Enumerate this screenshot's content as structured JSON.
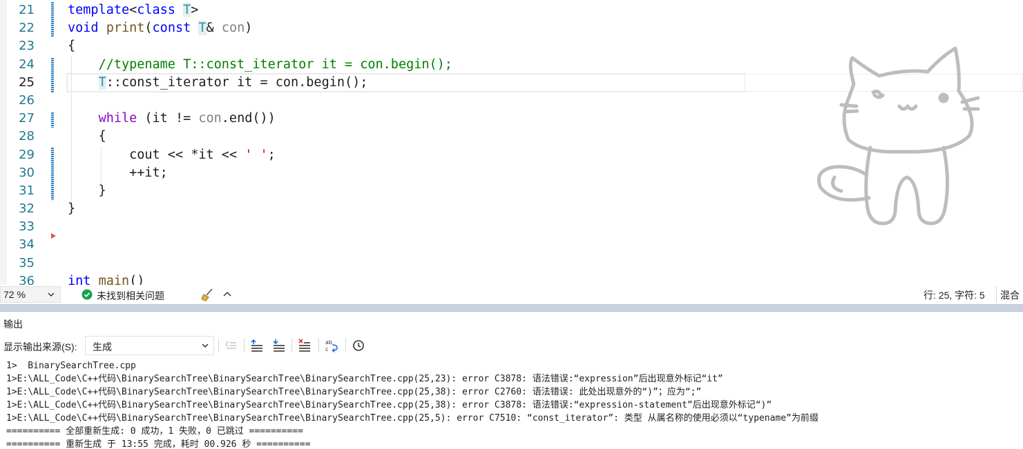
{
  "editor": {
    "line_numbers": [
      "21",
      "22",
      "23",
      "24",
      "25",
      "26",
      "27",
      "28",
      "29",
      "30",
      "31",
      "32",
      "33",
      "34",
      "35",
      "36"
    ],
    "current_line": "25",
    "code": {
      "l21_kw": "template",
      "l21_a": "<",
      "l21_kw2": "class",
      "l21_sp": " ",
      "l21_T": "T",
      "l21_b": ">",
      "l22_kw": "void",
      "l22_sp": " ",
      "l22_fn": "print",
      "l22_paren": "(",
      "l22_const": "const",
      "l22_sp2": " ",
      "l22_T": "T",
      "l22_amp": "& ",
      "l22_prm": "con",
      "l22_close": ")",
      "l23": "{",
      "l24_indent": "    ",
      "l24_cm": "//typename T::const_iterator it = con.begin();",
      "l25_indent": "    ",
      "l25_T": "T",
      "l25_rest": "::const_iterator it = con.begin();",
      "l26": "",
      "l27_indent": "    ",
      "l27_kw": "while",
      "l27_a": " (it != ",
      "l27_prm": "con",
      "l27_b": ".end())",
      "l28": "    {",
      "l29_a": "        cout << *it << ",
      "l29_str": "' '",
      "l29_b": ";",
      "l30": "        ++it;",
      "l31": "    }",
      "l32": "}",
      "l33": "",
      "l34": "",
      "l35": "",
      "l36_kw": "int",
      "l36_sp": " ",
      "l36_fn": "main",
      "l36_b": "()"
    }
  },
  "status_bar": {
    "zoom": "72 %",
    "issues": "未找到相关问题",
    "position": "行: 25, 字符: 5",
    "mode": "混合"
  },
  "output": {
    "title": "输出",
    "source_label": "显示输出来源(S):",
    "source_value": "生成",
    "lines": [
      "1>  BinarySearchTree.cpp",
      "1>E:\\ALL_Code\\C++代码\\BinarySearchTree\\BinarySearchTree\\BinarySearchTree.cpp(25,23): error C3878: 语法错误:“expression”后出现意外标记“it”",
      "1>E:\\ALL_Code\\C++代码\\BinarySearchTree\\BinarySearchTree\\BinarySearchTree.cpp(25,38): error C2760: 语法错误: 此处出现意外的“)”；应为“;”",
      "1>E:\\ALL_Code\\C++代码\\BinarySearchTree\\BinarySearchTree\\BinarySearchTree.cpp(25,38): error C3878: 语法错误:“expression-statement”后出现意外标记“)”",
      "1>E:\\ALL_Code\\C++代码\\BinarySearchTree\\BinarySearchTree\\BinarySearchTree.cpp(25,5): error C7510: “const_iterator”: 类型 从属名称的使用必须以“typename”为前缀",
      "========== 全部重新生成: 0 成功，1 失败，0 已跳过 ==========",
      "========== 重新生成 于 13:55 完成，耗时 00.926 秒 =========="
    ]
  },
  "colors": {
    "keyword": "#0000ff",
    "control_keyword": "#8f08c4",
    "comment": "#008000",
    "function": "#74531f",
    "parameter": "#808080",
    "string": "#a31515",
    "type_param": "#2b91af",
    "line_number": "#237893",
    "change_bar": "#2c82c9",
    "success_icon": "#16a34a",
    "splitter": "#c9d2df"
  },
  "icons": {
    "zoom_dropdown": "chevron-down-icon",
    "issues": "check-circle-icon",
    "cleanup": "broom-icon",
    "expand": "chevron-up-icon",
    "toolbar": [
      "go-to-error-icon",
      "previous-message-icon",
      "next-message-icon",
      "clear-all-icon",
      "word-wrap-icon",
      "clock-icon"
    ],
    "decoration": "cat-doodle-icon"
  }
}
